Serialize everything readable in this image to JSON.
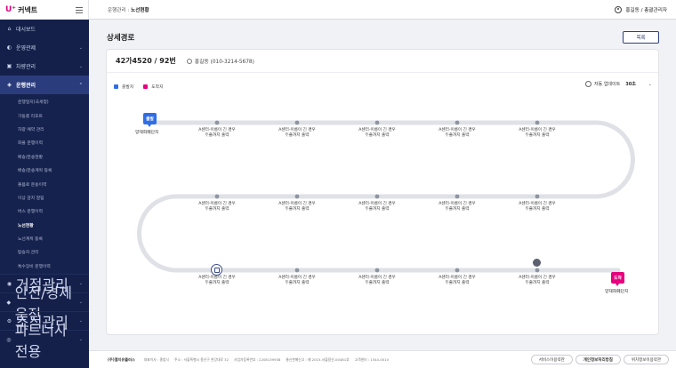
{
  "brand": {
    "mark": "U⁺",
    "name": "커넥트",
    "accent": "#e6007e"
  },
  "sidebar": {
    "top_items": [
      {
        "label": "대시보드",
        "icon": "home-icon"
      },
      {
        "label": "운영관제",
        "icon": "gauge-icon"
      },
      {
        "label": "차량관리",
        "icon": "truck-icon"
      },
      {
        "label": "운행관리",
        "icon": "route-icon"
      }
    ],
    "submenu": [
      "운행일지(국세청)",
      "가동률 리포트",
      "차량 예약 관리",
      "화물 운행이력",
      "배송/운송현황",
      "배송/운송계획 등록",
      "돌봄로 운송이력",
      "이상 감지 알림",
      "버스 운행이력",
      "노선현황",
      "노선계획 등록",
      "탑승자 관리",
      "특수장비 운행이력"
    ],
    "active_sub_index": 9,
    "bottom_items": [
      {
        "label": "거점관리",
        "icon": "pin-icon"
      },
      {
        "label": "안전/경제운전",
        "icon": "shield-icon"
      },
      {
        "label": "조직관리",
        "icon": "org-icon"
      },
      {
        "label": "파트너사 전용",
        "icon": "partner-icon"
      }
    ]
  },
  "header": {
    "crumb_parent": "운행관리",
    "crumb_sep": " : ",
    "crumb_current": "노선현황",
    "user_name": "홍길동",
    "user_role": "/ 총괄관리자"
  },
  "page": {
    "title": "상세경로",
    "list_button": "목록"
  },
  "vehicle": {
    "plate": "42가4520 / 92번",
    "driver": "홍길동 (010-3214-5678)"
  },
  "legend": {
    "start": "출발지",
    "end": "도착지",
    "start_color": "#2f6ee6",
    "end_color": "#e6007e"
  },
  "auto_update": {
    "label": "자동 업데이트",
    "value": "30초"
  },
  "route": {
    "start_pin": "출발",
    "end_pin": "도착",
    "start_name": "양재화훼단지",
    "end_name": "양재화훼단지",
    "stop_line1": "A센터-이름이 긴 경우",
    "stop_line2": "두줄까지 출력",
    "rows": [
      5,
      5,
      5
    ],
    "bus_position": {
      "row": 2,
      "stop": 0
    },
    "second_marker": {
      "row": 2,
      "stop": 4
    }
  },
  "footer": {
    "company": "(주)엘지유플러스",
    "info": [
      "대표이사 : 홍범식",
      "주소 : 서울특별시 용산구 한강대로 32",
      "사업자등록번호 : 2208139938",
      "통신판매신고 : 제 2015-서울용산-00481호",
      "고객센터 : 1544-0010"
    ],
    "buttons": [
      "서비스이용약관",
      "개인정보처리방침",
      "위치정보이용약관"
    ]
  }
}
